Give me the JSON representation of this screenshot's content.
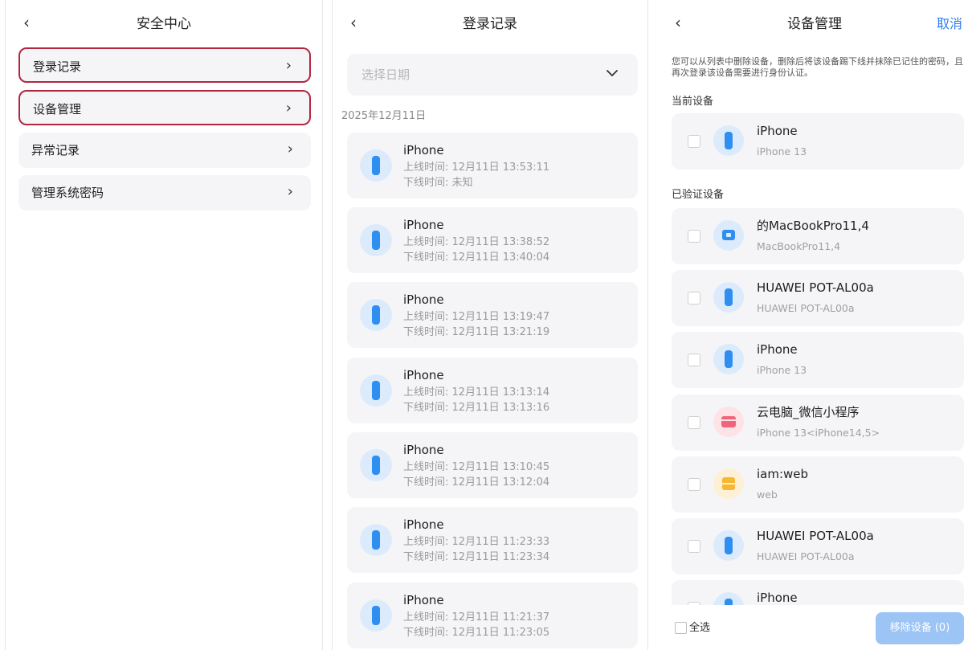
{
  "security_center": {
    "title": "安全中心",
    "back_icon": "chevron-left-icon",
    "items": [
      {
        "label": "登录记录",
        "highlighted": true
      },
      {
        "label": "设备管理",
        "highlighted": true
      },
      {
        "label": "异常记录",
        "highlighted": false
      },
      {
        "label": "管理系统密码",
        "highlighted": false
      }
    ]
  },
  "login_records": {
    "title": "登录记录",
    "date_select": {
      "placeholder": "选择日期"
    },
    "date_header": "2025年12月11日",
    "records": [
      {
        "name": "iPhone",
        "online": "上线时间: 12月11日 13:53:11",
        "offline": "下线时间: 未知"
      },
      {
        "name": "iPhone",
        "online": "上线时间: 12月11日 13:38:52",
        "offline": "下线时间: 12月11日 13:40:04"
      },
      {
        "name": "iPhone",
        "online": "上线时间: 12月11日 13:19:47",
        "offline": "下线时间: 12月11日 13:21:19"
      },
      {
        "name": "iPhone",
        "online": "上线时间: 12月11日 13:13:14",
        "offline": "下线时间: 12月11日 13:13:16"
      },
      {
        "name": "iPhone",
        "online": "上线时间: 12月11日 13:10:45",
        "offline": "下线时间: 12月11日 13:12:04"
      },
      {
        "name": "iPhone",
        "online": "上线时间: 12月11日 11:23:33",
        "offline": "下线时间: 12月11日 11:23:34"
      },
      {
        "name": "iPhone",
        "online": "上线时间: 12月11日 11:21:37",
        "offline": "下线时间: 12月11日 11:23:05"
      }
    ]
  },
  "device_management": {
    "title": "设备管理",
    "cancel": "取消",
    "description": "您可以从列表中删除设备，删除后将该设备踢下线并抹除已记住的密码，且再次登录该设备需要进行身份认证。",
    "current_section": "当前设备",
    "current_device": {
      "name": "iPhone",
      "model": "iPhone 13",
      "icon": "phone-icon"
    },
    "verified_section": "已验证设备",
    "verified_devices": [
      {
        "name": "的MacBookPro11,4",
        "model": "MacBookPro11,4",
        "icon": "laptop-icon"
      },
      {
        "name": "HUAWEI POT-AL00a",
        "model": "HUAWEI POT-AL00a",
        "icon": "phone-icon"
      },
      {
        "name": "iPhone",
        "model": "iPhone 13",
        "icon": "phone-icon"
      },
      {
        "name": "云电脑_微信小程序",
        "model": "iPhone 13<iPhone14,5>",
        "icon": "cloud-pc-icon"
      },
      {
        "name": "iam:web",
        "model": "web",
        "icon": "web-icon"
      },
      {
        "name": "HUAWEI POT-AL00a",
        "model": "HUAWEI POT-AL00a",
        "icon": "phone-icon"
      },
      {
        "name": "iPhone",
        "model": "",
        "icon": "phone-icon"
      }
    ],
    "select_all": "全选",
    "remove_button": "移除设备 (0)"
  },
  "colors": {
    "accent": "#2e7cf6",
    "highlight_border": "#b3263f",
    "card_bg": "#f5f5f7"
  }
}
